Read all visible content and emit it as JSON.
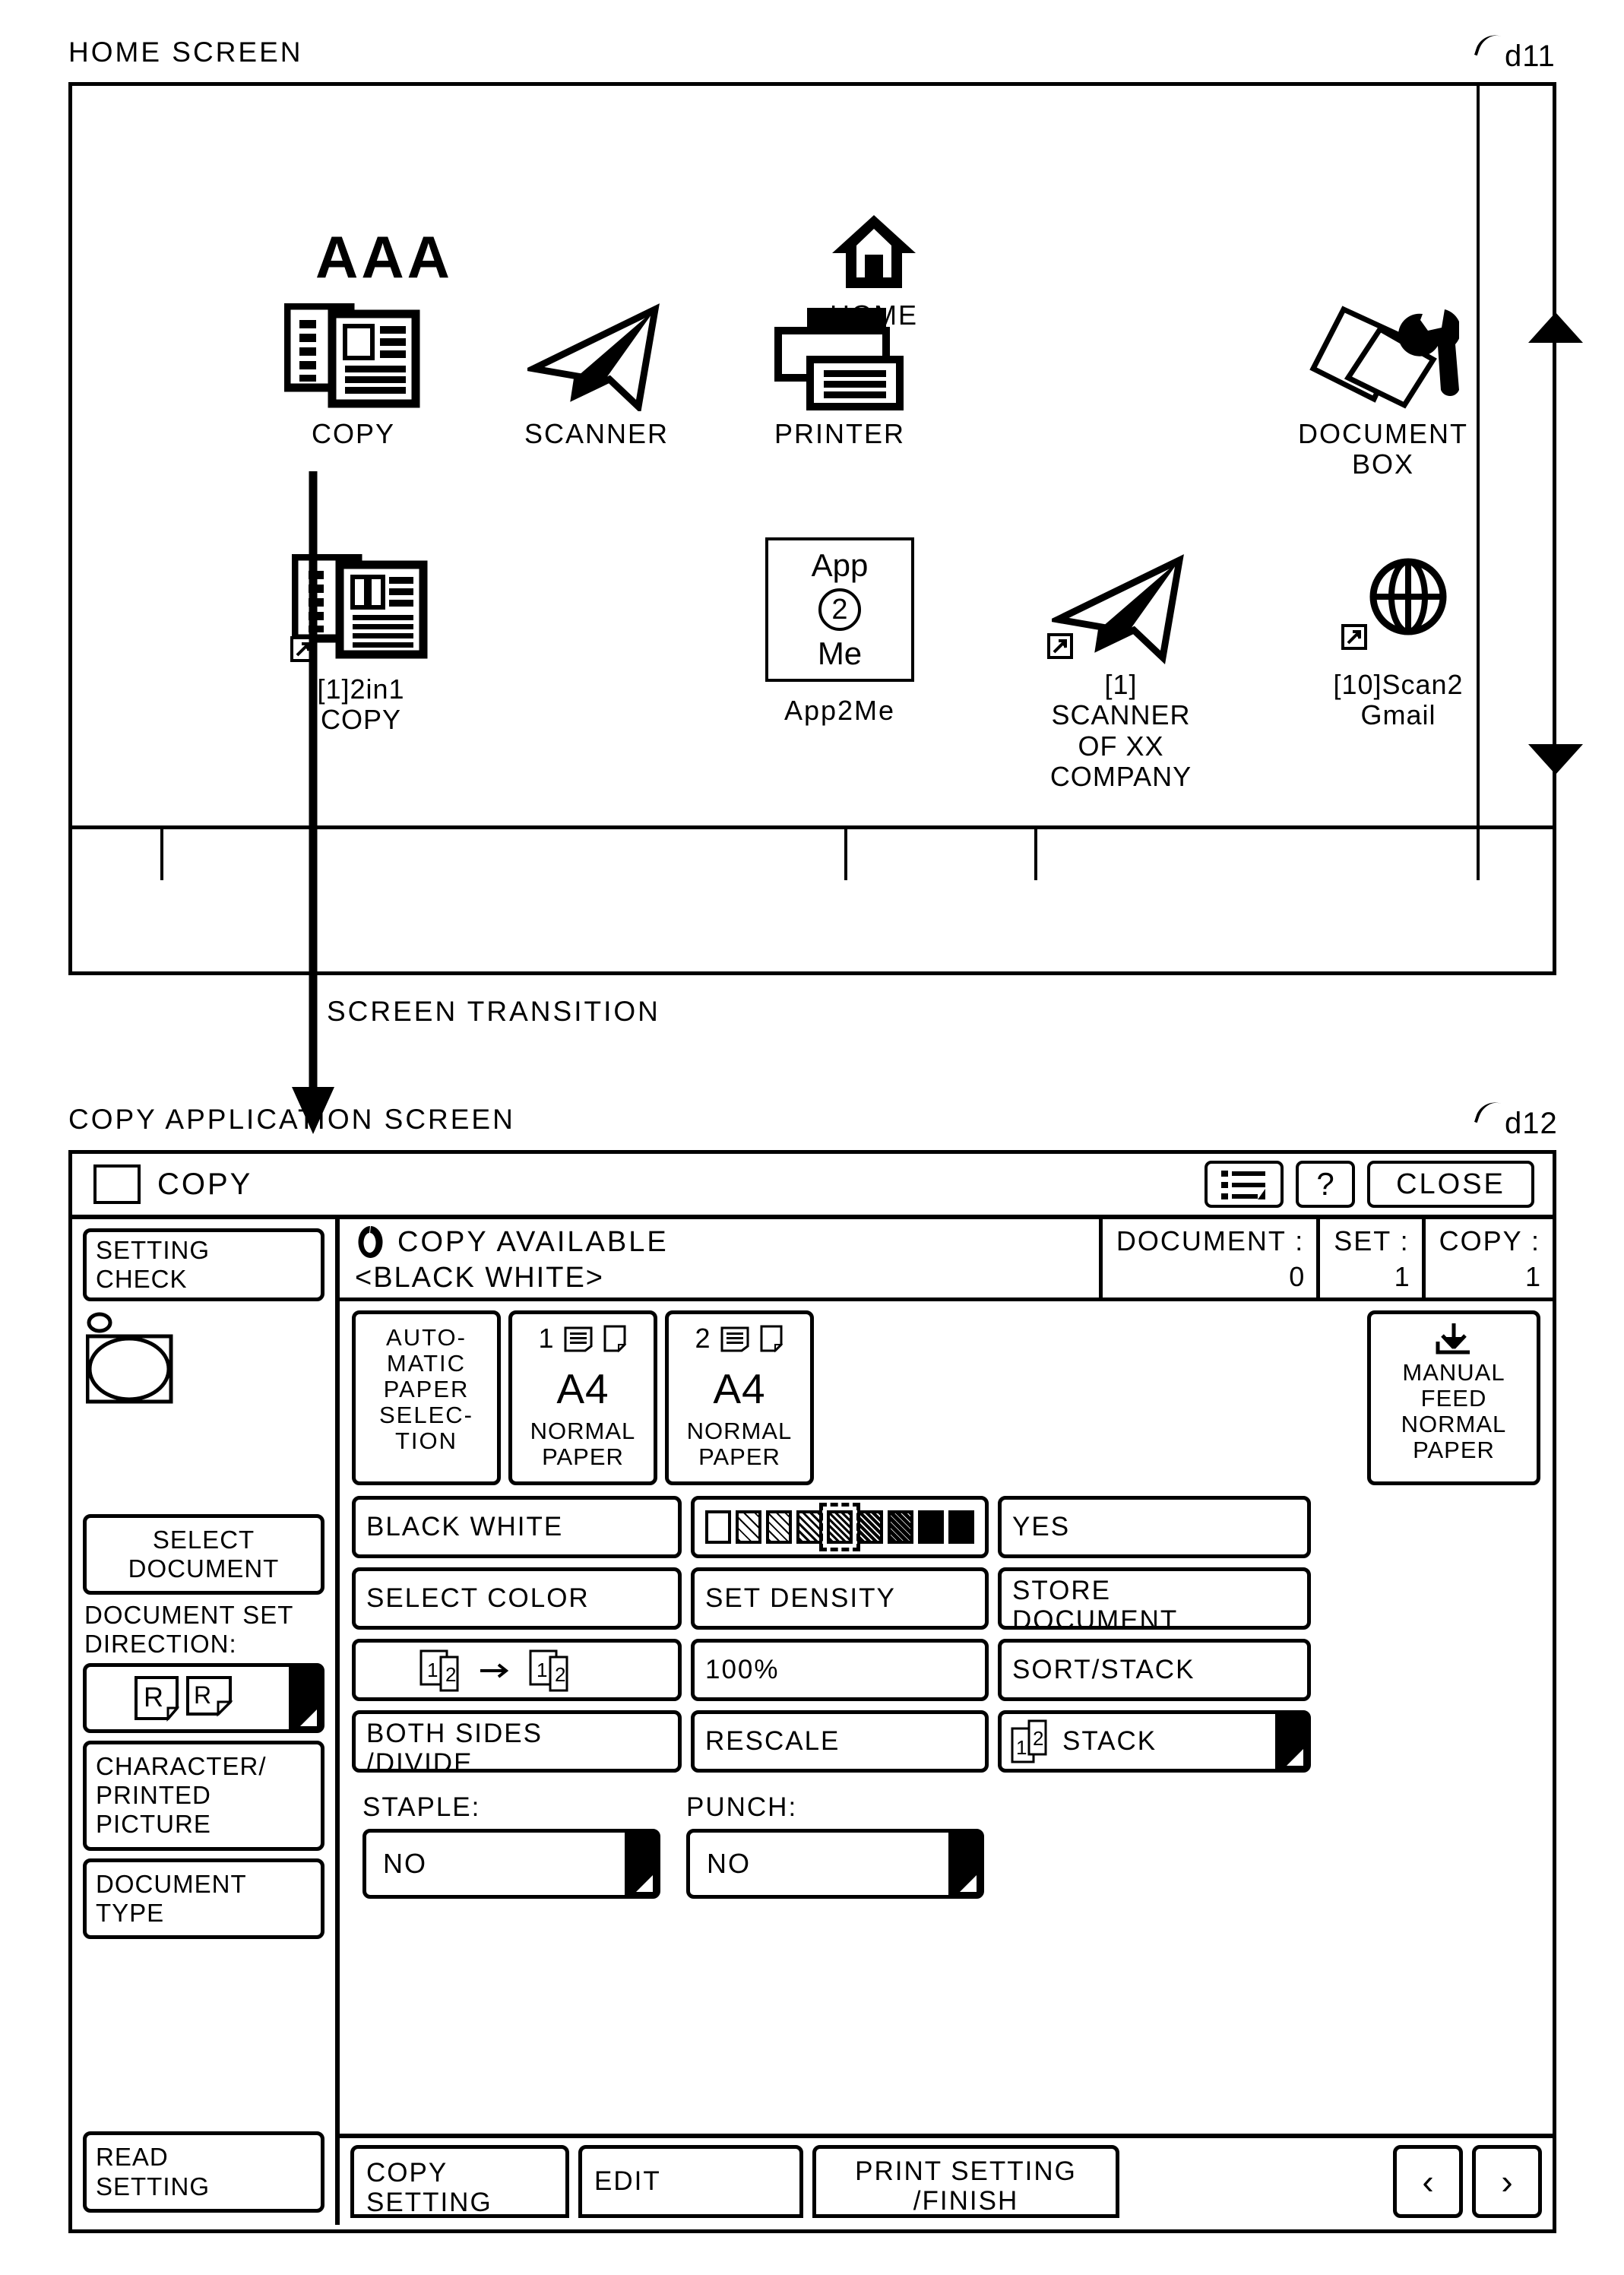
{
  "figure": {
    "home_caption": "HOME SCREEN",
    "home_ref": "d11",
    "copy_caption": "COPY APPLICATION SCREEN",
    "copy_ref": "d12",
    "transition_label": "SCREEN TRANSITION"
  },
  "home": {
    "logo": "AAA",
    "home_button_label": "HOME",
    "row1": [
      {
        "label": "COPY",
        "icon": "copy-documents-icon"
      },
      {
        "label": "SCANNER",
        "icon": "scanner-paper-plane-icon"
      },
      {
        "label": "PRINTER",
        "icon": "printer-icon"
      },
      {
        "label": "DOCUMENT\nBOX",
        "label_line1": "DOCUMENT",
        "label_line2": "BOX",
        "icon": "document-box-wrench-icon"
      }
    ],
    "row2": [
      {
        "label_line1": "[1]2in1",
        "label_line2": "COPY",
        "icon": "copy-documents-shortcut-icon"
      },
      {
        "label_line1": "App2Me",
        "icon": "app2me-icon",
        "tile_line1": "App",
        "tile_line2": "2",
        "tile_line3": "Me"
      },
      {
        "label_line1": "[1]",
        "label_line2": "SCANNER",
        "label_line3": "OF XX",
        "label_line4": "COMPANY",
        "icon": "scanner-paper-plane-shortcut-icon"
      },
      {
        "label_line1": "[10]Scan2",
        "label_line2": "Gmail",
        "icon": "globe-shortcut-icon"
      }
    ],
    "scroll_up": "scroll-up-arrow-icon",
    "scroll_down": "scroll-down-arrow-icon"
  },
  "copy": {
    "titlebar": {
      "app_title": "COPY",
      "list_button": "list-menu-icon",
      "help_button": "?",
      "close_button": "CLOSE"
    },
    "status": {
      "ready_text": "COPY AVAILABLE",
      "mode_text": "<BLACK WHITE>",
      "counters": [
        {
          "key": "DOCUMENT :",
          "value": "0"
        },
        {
          "key": "SET :",
          "value": "1"
        },
        {
          "key": "COPY :",
          "value": "1"
        }
      ]
    },
    "sidebar": {
      "setting_check": "SETTING\nCHECK",
      "setting_check_l1": "SETTING",
      "setting_check_l2": "CHECK",
      "select_document_l1": "SELECT",
      "select_document_l2": "DOCUMENT",
      "direction_label_l1": "DOCUMENT SET",
      "direction_label_l2": "DIRECTION:",
      "direction_button": "document-orientation-R-R-icon",
      "char_picture_l1": "CHARACTER/",
      "char_picture_l2": "PRINTED",
      "char_picture_l3": "PICTURE",
      "document_type_l1": "DOCUMENT",
      "document_type_l2": "TYPE",
      "read_setting_l1": "READ",
      "read_setting_l2": "SETTING"
    },
    "paper": {
      "auto_l1": "AUTO-",
      "auto_l2": "MATIC",
      "auto_l3": "PAPER",
      "auto_l4": "SELEC-",
      "auto_l5": "TION",
      "trays": [
        {
          "num": "1",
          "size": "A4",
          "type_l1": "NORMAL",
          "type_l2": "PAPER"
        },
        {
          "num": "2",
          "size": "A4",
          "type_l1": "NORMAL",
          "type_l2": "PAPER"
        }
      ],
      "manual_l1": "MANUAL",
      "manual_l2": "FEED",
      "manual_l3": "NORMAL",
      "manual_l4": "PAPER"
    },
    "options": {
      "black_white": "BLACK WHITE",
      "density_yes": "YES",
      "select_color": "SELECT COLOR",
      "set_density": "SET DENSITY",
      "store_document": "STORE\nDOCUMENT",
      "store_document_l1": "STORE",
      "store_document_l2": "DOCUMENT",
      "scale_value": "100%",
      "sort_stack": "SORT/STACK",
      "both_sides_l1": "BOTH SIDES",
      "both_sides_l2": "/DIVIDE",
      "rescale": "RESCALE",
      "stack": "STACK",
      "density_levels": 9,
      "density_selected_index": 5
    },
    "finish": {
      "staple_label": "STAPLE:",
      "staple_value": "NO",
      "punch_label": "PUNCH:",
      "punch_value": "NO"
    },
    "tabs": [
      {
        "l1": "COPY",
        "l2": "SETTING"
      },
      {
        "l1": "EDIT",
        "l2": ""
      },
      {
        "l1": "PRINT SETTING",
        "l2": "/FINISH"
      }
    ],
    "nav": {
      "prev": "‹",
      "next": "›"
    }
  }
}
